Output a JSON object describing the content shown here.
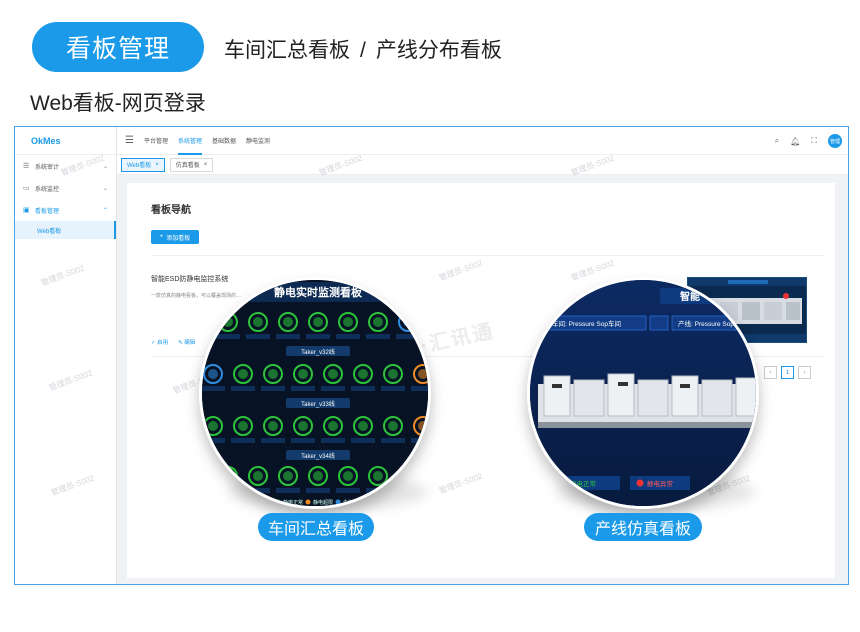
{
  "header": {
    "pill_label": "看板管理",
    "subtitle_left": "车间汇总看板",
    "subtitle_sep": "/",
    "subtitle_right": "产线分布看板"
  },
  "section_title": "Web看板-网页登录",
  "app": {
    "logo": "OkMes",
    "sidebar": {
      "items": [
        {
          "label": "系统审计",
          "icon": "audit-icon",
          "arrow": "⌄"
        },
        {
          "label": "系统监控",
          "icon": "monitor-icon",
          "arrow": "⌄"
        },
        {
          "label": "看板管理",
          "icon": "dashboard-icon",
          "arrow": "⌃"
        }
      ],
      "sub_item": "Web看板"
    },
    "topbar": {
      "nav": [
        "平台管理",
        "系统管理",
        "基础数据",
        "静电监测"
      ],
      "avatar": "管理"
    },
    "tabs": [
      {
        "label": "Web看板",
        "close": "×"
      },
      {
        "label": "仿真看板",
        "close": "×"
      }
    ],
    "content": {
      "title": "看板导航",
      "add_button": "添加看板",
      "item_name": "智能ESD防静电监控系统",
      "item_desc": "一款仿真的静电看板，可以覆盖现场的…",
      "action_enable": "启用",
      "action_edit": "编辑",
      "page_current": "1"
    },
    "watermark": "管理员-S002",
    "brand_watermark": "SUN·汇讯通"
  },
  "magnifier1": {
    "screen_title": "静电实时监测看板",
    "line_labels": [
      "Taker_v32线",
      "Taker_v33线",
      "Taker_v34线"
    ],
    "legend": [
      "静电正常",
      "静电超限",
      "未连接"
    ],
    "caption": "车间汇总看板"
  },
  "magnifier2": {
    "screen_title": "智能",
    "workshop_label": "车间: Pressure Sop车间",
    "line_label": "产线: Pressure Sop产线",
    "status_ok": "静电正常",
    "status_alarm": "静电异常",
    "caption": "产线仿真看板"
  },
  "colors": {
    "accent": "#1a9ae8",
    "ok": "#2bc43a",
    "warn": "#f08a22",
    "offline": "#2f8de0"
  }
}
